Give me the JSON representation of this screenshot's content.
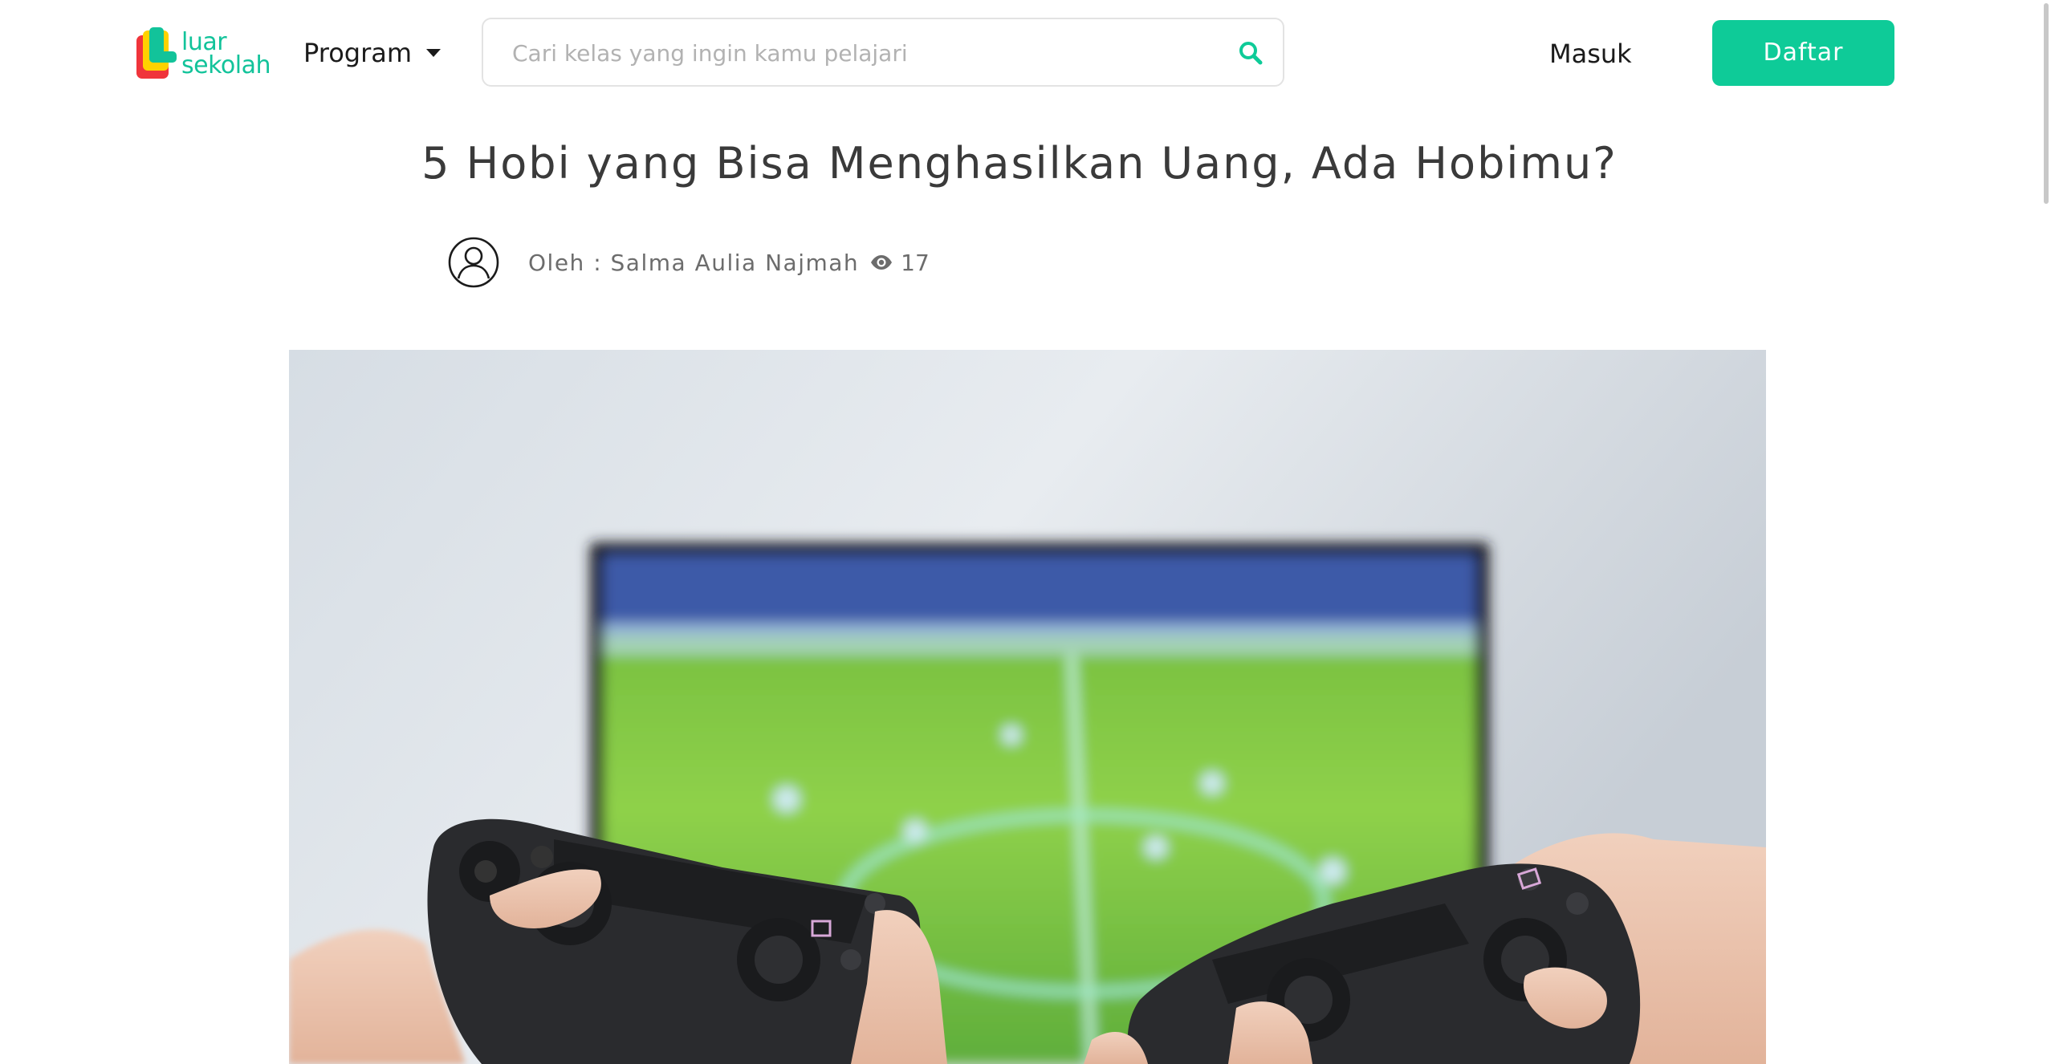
{
  "brand": {
    "logo_line1": "luar",
    "logo_line2": "sekolah",
    "colors": {
      "accent": "#0ecb98",
      "logo_red": "#f0343b",
      "logo_yellow": "#ffd200",
      "logo_green": "#12c39a"
    }
  },
  "nav": {
    "program_label": "Program",
    "search_placeholder": "Cari kelas yang ingin kamu pelajari",
    "search_icon": "search-icon",
    "login_label": "Masuk",
    "register_label": "Daftar"
  },
  "article": {
    "title": "5 Hobi yang Bisa Menghasilkan Uang, Ada Hobimu?",
    "author_line": "Oleh : Salma Aulia Najmah",
    "views": "17",
    "avatar_icon": "user-circle-icon",
    "views_icon": "eye-icon"
  }
}
